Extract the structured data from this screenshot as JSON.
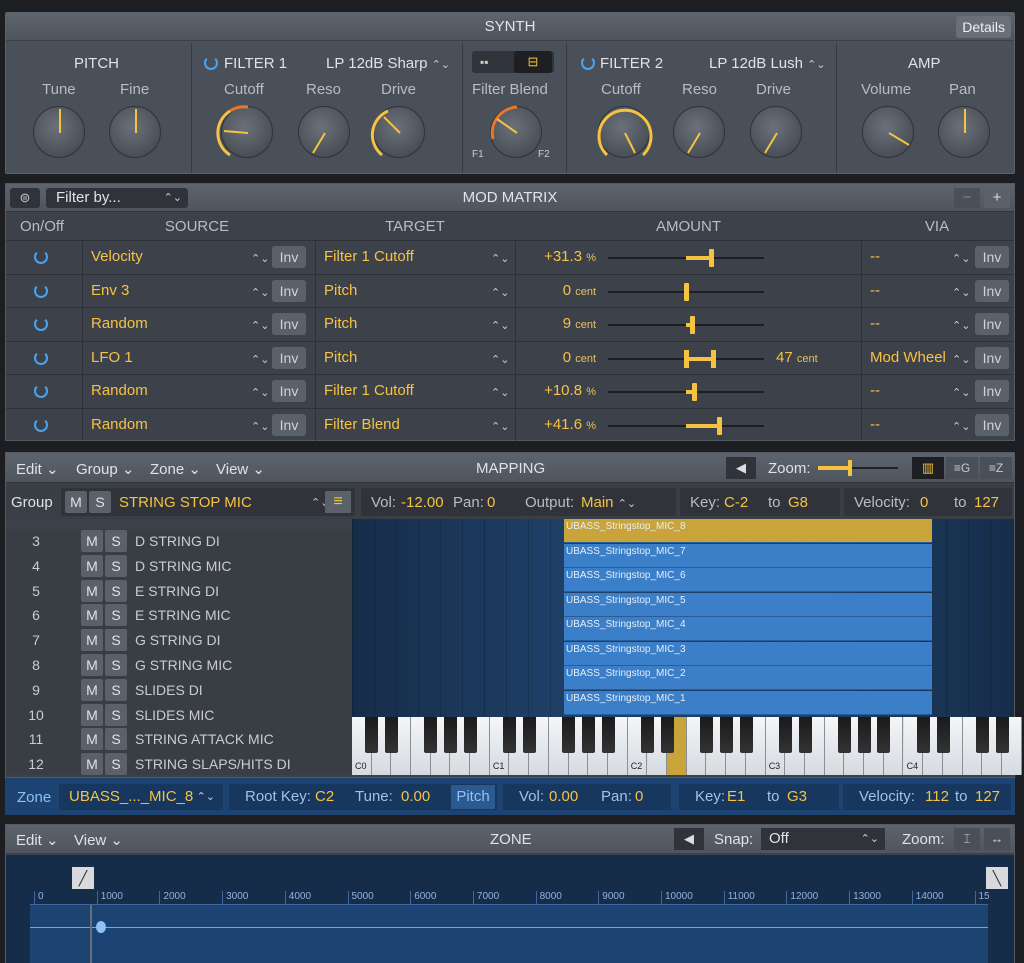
{
  "synth": {
    "title": "SYNTH",
    "details": "Details",
    "pitch": {
      "title": "PITCH",
      "tune": "Tune",
      "fine": "Fine"
    },
    "filter1": {
      "title": "FILTER 1",
      "type": "LP 12dB Sharp",
      "cutoff": "Cutoff",
      "reso": "Reso",
      "drive": "Drive"
    },
    "blend": {
      "title": "Filter Blend",
      "f1": "F1",
      "f2": "F2"
    },
    "filter2": {
      "title": "FILTER 2",
      "type": "LP 12dB Lush",
      "cutoff": "Cutoff",
      "reso": "Reso",
      "drive": "Drive"
    },
    "amp": {
      "title": "AMP",
      "volume": "Volume",
      "pan": "Pan"
    }
  },
  "mod": {
    "title": "MOD MATRIX",
    "filter": "Filter by...",
    "minus": "−",
    "plus": "+",
    "headers": [
      "On/Off",
      "SOURCE",
      "TARGET",
      "AMOUNT",
      "VIA"
    ],
    "rows": [
      {
        "source": "Velocity",
        "inv": "Inv",
        "target": "Filter 1 Cutoff",
        "amount": "+31.3",
        "unit": "%",
        "extra": "",
        "extra_unit": "",
        "via": "--",
        "via_inv": "Inv",
        "level": 0.66
      },
      {
        "source": "Env 3",
        "inv": "Inv",
        "target": "Pitch",
        "amount": "0",
        "unit": "cent",
        "extra": "",
        "extra_unit": "",
        "via": "--",
        "via_inv": "Inv",
        "level": 0.5
      },
      {
        "source": "Random",
        "inv": "Inv",
        "target": "Pitch",
        "amount": "9",
        "unit": "cent",
        "extra": "",
        "extra_unit": "",
        "via": "--",
        "via_inv": "Inv",
        "level": 0.54
      },
      {
        "source": "LFO 1",
        "inv": "Inv",
        "target": "Pitch",
        "amount": "0",
        "unit": "cent",
        "extra": "47",
        "extra_unit": "cent",
        "via": "Mod Wheel",
        "via_inv": "Inv",
        "level": 0.5
      },
      {
        "source": "Random",
        "inv": "Inv",
        "target": "Filter 1 Cutoff",
        "amount": "+10.8",
        "unit": "%",
        "extra": "",
        "extra_unit": "",
        "via": "--",
        "via_inv": "Inv",
        "level": 0.55
      },
      {
        "source": "Random",
        "inv": "Inv",
        "target": "Filter Blend",
        "amount": "+41.6",
        "unit": "%",
        "extra": "",
        "extra_unit": "",
        "via": "--",
        "via_inv": "Inv",
        "level": 0.71
      }
    ]
  },
  "mapping": {
    "title": "MAPPING",
    "edit": "Edit",
    "group": "Group",
    "zone": "Zone",
    "view": "View",
    "zoom": "Zoom:",
    "group_bar": {
      "label": "Group",
      "m": "M",
      "s": "S",
      "name": "STRING STOP MIC",
      "vol_l": "Vol:",
      "vol": "-12.00",
      "pan_l": "Pan:",
      "pan": "0",
      "out_l": "Output:",
      "out": "Main",
      "key_l": "Key:",
      "key_lo": "C-2",
      "to": "to",
      "key_hi": "G8",
      "vel_l": "Velocity:",
      "vel_lo": "0",
      "vel_hi": "127"
    },
    "groups": [
      {
        "n": "3",
        "name": "D STRING DI"
      },
      {
        "n": "4",
        "name": "D STRING MIC"
      },
      {
        "n": "5",
        "name": "E STRING DI"
      },
      {
        "n": "6",
        "name": "E STRING MIC"
      },
      {
        "n": "7",
        "name": "G STRING DI"
      },
      {
        "n": "8",
        "name": "G STRING MIC"
      },
      {
        "n": "9",
        "name": "SLIDES DI"
      },
      {
        "n": "10",
        "name": "SLIDES MIC"
      },
      {
        "n": "11",
        "name": "STRING ATTACK MIC"
      },
      {
        "n": "12",
        "name": "STRING SLAPS/HITS DI"
      }
    ],
    "zones": [
      "UBASS_Stringstop_MIC_8",
      "UBASS_Stringstop_MIC_7",
      "UBASS_Stringstop_MIC_6",
      "UBASS_Stringstop_MIC_5",
      "UBASS_Stringstop_MIC_4",
      "UBASS_Stringstop_MIC_3",
      "UBASS_Stringstop_MIC_2",
      "UBASS_Stringstop_MIC_1"
    ],
    "octaves": [
      "C0",
      "C1",
      "C2",
      "C3",
      "C4"
    ]
  },
  "zone_bar": {
    "label": "Zone",
    "name": "UBASS_..._MIC_8",
    "root_l": "Root Key:",
    "root": "C2",
    "tune_l": "Tune:",
    "tune": "0.00",
    "pitch": "Pitch",
    "vol_l": "Vol:",
    "vol": "0.00",
    "pan_l": "Pan:",
    "pan": "0",
    "key_l": "Key:",
    "key_lo": "E1",
    "to": "to",
    "key_hi": "G3",
    "vel_l": "Velocity:",
    "vel_lo": "112",
    "vel_hi": "127"
  },
  "zone": {
    "title": "ZONE",
    "edit": "Edit",
    "view": "View",
    "snap_l": "Snap:",
    "snap": "Off",
    "zoom": "Zoom:",
    "ruler": [
      "0",
      "1000",
      "2000",
      "3000",
      "4000",
      "5000",
      "6000",
      "7000",
      "8000",
      "9000",
      "10000",
      "11000",
      "12000",
      "13000",
      "14000",
      "15"
    ]
  },
  "colors": {
    "accent": "#f5c242",
    "blue": "#4aa3f0",
    "zone": "#3a7fc8"
  }
}
